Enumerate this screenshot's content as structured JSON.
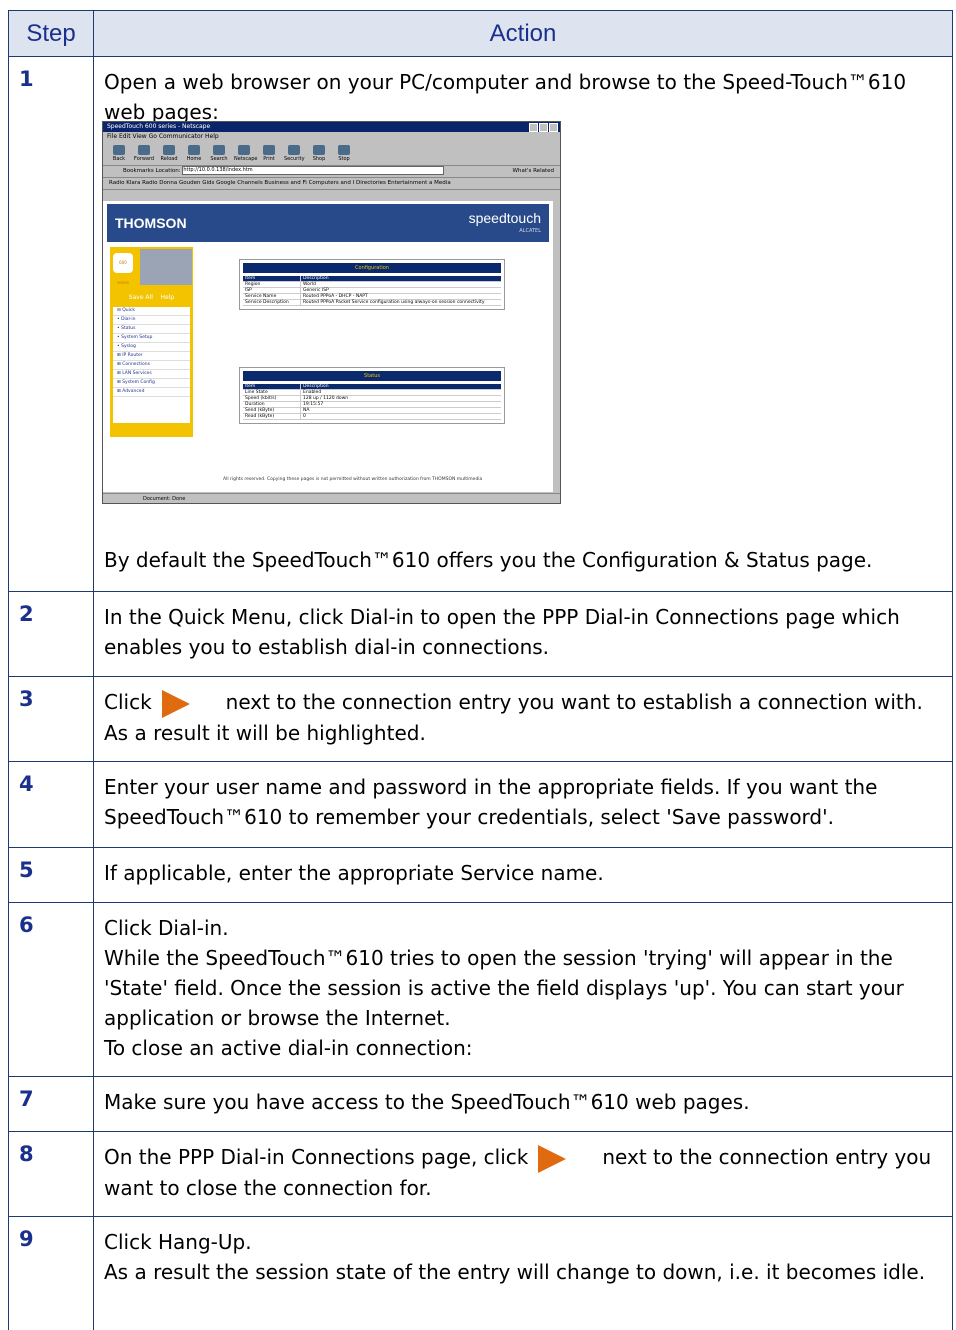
{
  "table": {
    "header": {
      "step": "Step",
      "action": "Action"
    },
    "rows": [
      {
        "num": "1",
        "line1": "Open a web browser on your PC/computer and browse to the Speed-Touch™610 web pages:",
        "line2": "By default the SpeedTouch™610 offers you the Configuration & Status page."
      },
      {
        "num": "2",
        "text": "In the Quick Menu, click Dial-in to open the PPP Dial-in Connections page which enables you to establish dial-in connections."
      },
      {
        "num": "3",
        "before": "Click",
        "after": "next to the connection entry you want to establish a connection with. As a result it will be highlighted.",
        "icon": "orange-arrow-icon"
      },
      {
        "num": "4",
        "text": "Enter your user name and password in the appropriate fields. If you want the SpeedTouch™610 to remember your credentials, select 'Save password'."
      },
      {
        "num": "5",
        "text": "If applicable, enter the appropriate Service name."
      },
      {
        "num": "6",
        "l1": "Click Dial-in.",
        "l2": "While the SpeedTouch™610 tries to open the session 'trying' will appear in the 'State' field. Once the session is active the field displays 'up'. You can start your application or browse the Internet.",
        "l3": "To close an active dial-in connection:"
      },
      {
        "num": "7",
        "text": "Make sure you have access to the SpeedTouch™610 web pages."
      },
      {
        "num": "8",
        "before": "On the PPP Dial-in Connections page, click",
        "after": "next to the connection entry you want to close the connection for.",
        "icon": "orange-arrow-icon"
      },
      {
        "num": "9",
        "l1": "Click Hang-Up.",
        "l2": "As a result the session state of the entry will change to down, i.e. it becomes idle."
      }
    ]
  },
  "screenshot": {
    "window_title": "SpeedTouch 600 series - Netscape",
    "menu": "File  Edit  View  Go  Communicator  Help",
    "toolbar": [
      "Back",
      "Forward",
      "Reload",
      "Home",
      "Search",
      "Netscape",
      "Print",
      "Security",
      "Shop",
      "Stop"
    ],
    "location_label": "Bookmarks   Location:",
    "url": "http://10.0.0.138/index.htm",
    "whats_related": "What's Related",
    "bookmarks": "Radio Klara   Radio Donna   Gouden Gids   Google   Channels   Business and Fi   Computers and I   Directories   Entertainment a   Media",
    "brand": "THOMSON",
    "product": "speedtouch",
    "alcatel": "ALCATEL",
    "series": "600 series",
    "save_all": "Save All",
    "help": "Help",
    "menu_items": [
      "⊟ Quick",
      "• Dial-in",
      "• Status",
      "• System Setup",
      "• Syslog",
      "⊞ IP Router",
      "⊞ Connections",
      "⊞ LAN Services",
      "⊞ System Config",
      "⊞ Advanced"
    ],
    "config_title": "Configuration",
    "config_rows": [
      [
        "Item",
        "Description"
      ],
      [
        "Region",
        "World"
      ],
      [
        "ISP",
        "Generic ISP"
      ],
      [
        "Service Name",
        "Routed PPPoA - DHCP - NAPT"
      ],
      [
        "Service Description",
        "Routed PPPoA Packet Service configuration using always-on session connectivity"
      ]
    ],
    "status_title": "Status",
    "status_rows": [
      [
        "Item",
        "Description"
      ],
      [
        "Line State",
        "Enabled"
      ],
      [
        "Speed (kbit/s)",
        "128 up / 1120 down"
      ],
      [
        "Duration",
        "19:15:57"
      ],
      [
        "Send (kByte)",
        "NA"
      ],
      [
        "Read (kByte)",
        "0"
      ]
    ],
    "footer": "All rights reserved. Copying these pages is not permitted without written authorization from THOMSON multimedia",
    "status_text": "Document: Done"
  }
}
